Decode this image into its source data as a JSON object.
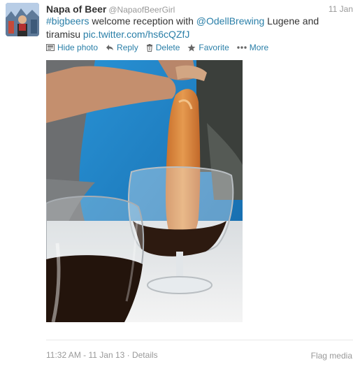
{
  "tweet": {
    "author_name": "Napa of Beer",
    "author_handle": "@NapaofBeerGirl",
    "date": "11 Jan",
    "text": {
      "hashtag": "#bigbeers",
      "part1": " welcome reception with ",
      "mention": "@OdellBrewing",
      "part2": " Lugene and tiramisu ",
      "url": "pic.twitter.com/hs6cQZfJ"
    }
  },
  "actions": [
    {
      "label": "Hide photo",
      "icon": "photo-icon"
    },
    {
      "label": "Reply",
      "icon": "reply-icon"
    },
    {
      "label": "Delete",
      "icon": "trash-icon"
    },
    {
      "label": "Favorite",
      "icon": "star-icon"
    },
    {
      "label": "More",
      "icon": "dots-icon"
    }
  ],
  "footer": {
    "timestamp": "11:32 AM - 11 Jan 13 · ",
    "details": "Details",
    "flag": "Flag media"
  },
  "colors": {
    "link": "#2a7fa8",
    "meta": "#999999",
    "text": "#333333"
  }
}
